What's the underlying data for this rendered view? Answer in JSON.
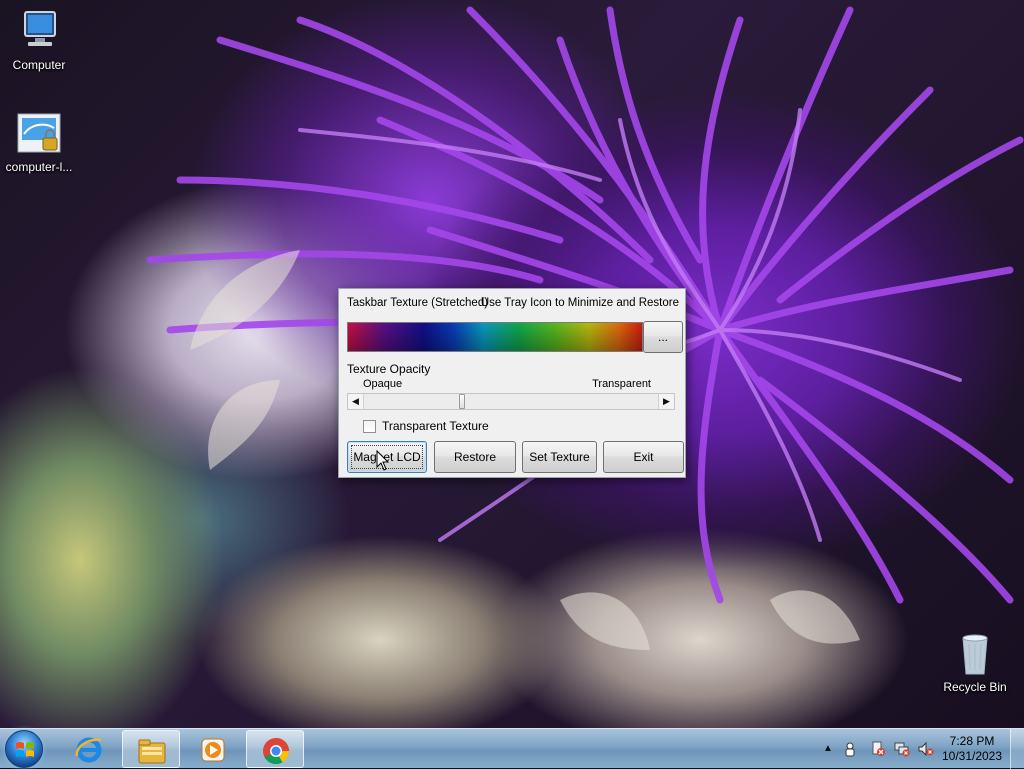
{
  "desktop": {
    "icons": [
      {
        "label": "Computer",
        "icon": "computer-icon"
      },
      {
        "label": "computer-l...",
        "icon": "network-lock-icon"
      },
      {
        "label": "Recycle Bin",
        "icon": "recycle-bin-icon"
      }
    ]
  },
  "app": {
    "caption_left": "Taskbar Texture (Stretched)",
    "caption_right": "Use Tray Icon to Minimize and Restore",
    "browse_label": "...",
    "opacity_label": "Texture Opacity",
    "slider_min_label": "Opaque",
    "slider_max_label": "Transparent",
    "slider_value_fraction": 0.33,
    "transparent_texture_label": "Transparent Texture",
    "transparent_texture_checked": false,
    "buttons": {
      "magnet": "Magnet LCD",
      "restore": "Restore",
      "set_texture": "Set Texture",
      "exit": "Exit"
    }
  },
  "taskbar": {
    "pinned": [
      {
        "name": "internet-explorer-icon"
      },
      {
        "name": "file-explorer-icon",
        "active": true
      },
      {
        "name": "media-player-icon"
      },
      {
        "name": "chrome-icon",
        "active": true
      }
    ],
    "clock": {
      "time": "7:28 PM",
      "date": "10/31/2023"
    }
  }
}
